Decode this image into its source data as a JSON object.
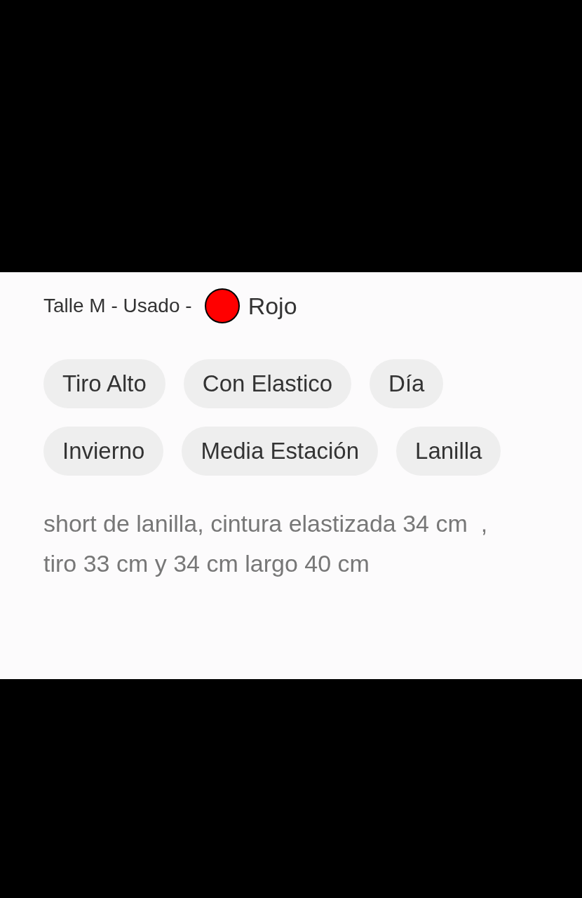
{
  "details": {
    "condition": "Talle M - Usado -",
    "color": {
      "name": "Rojo",
      "color": "#ff0000"
    }
  },
  "tags": [
    "Tiro Alto",
    "Con Elastico",
    "Día",
    "Invierno",
    "Media Estación",
    "Lanilla"
  ],
  "description": "short de lanilla, cintura elastizada 34 cm  , tiro 33 cm y 34 cm largo 40 cm"
}
